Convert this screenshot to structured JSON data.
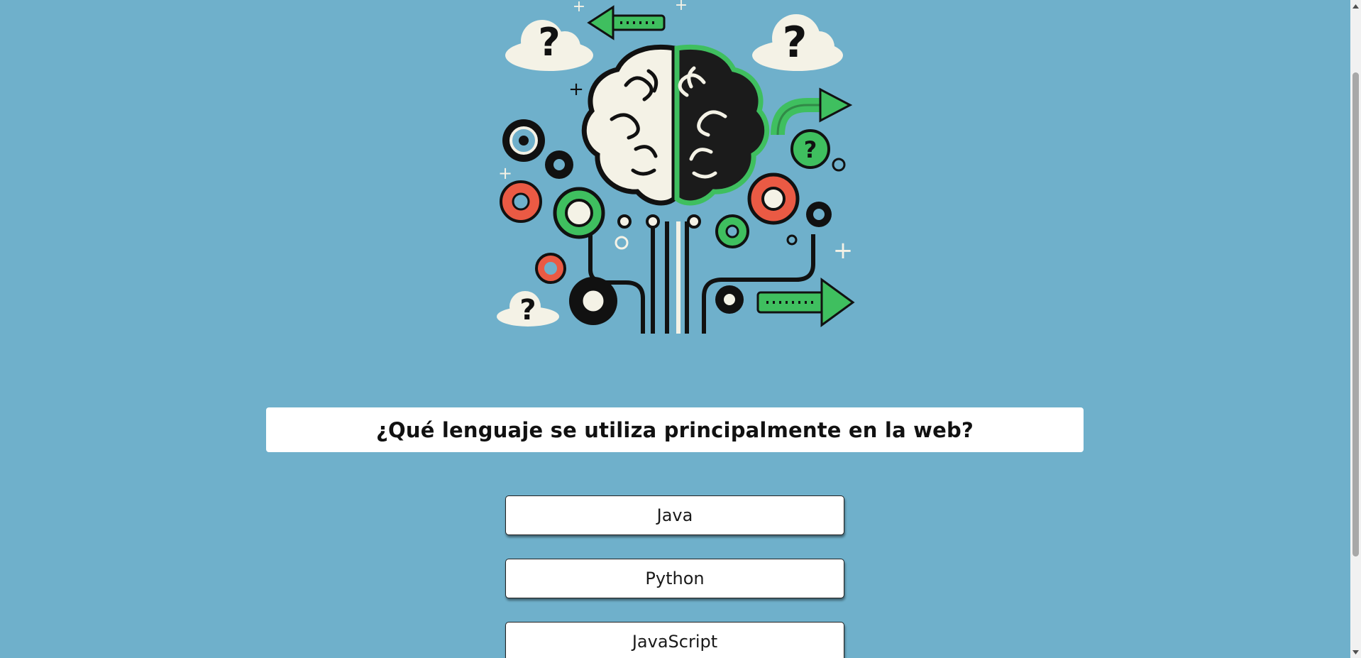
{
  "quiz": {
    "illustration_alt": "brain-with-gears-illustration",
    "question": "¿Qué lenguaje se utiliza principalmente en la web?",
    "answers": [
      {
        "label": "Java"
      },
      {
        "label": "Python"
      },
      {
        "label": "JavaScript"
      }
    ]
  },
  "colors": {
    "background": "#6fb0cb",
    "card": "#ffffff",
    "accent_green": "#3fbf5f",
    "accent_red": "#ea5a44",
    "ink": "#1a1a1a"
  },
  "icons": {
    "illustration": "brain-gears-icon",
    "scroll_up": "chevron-up-icon",
    "scroll_down": "chevron-down-icon"
  }
}
